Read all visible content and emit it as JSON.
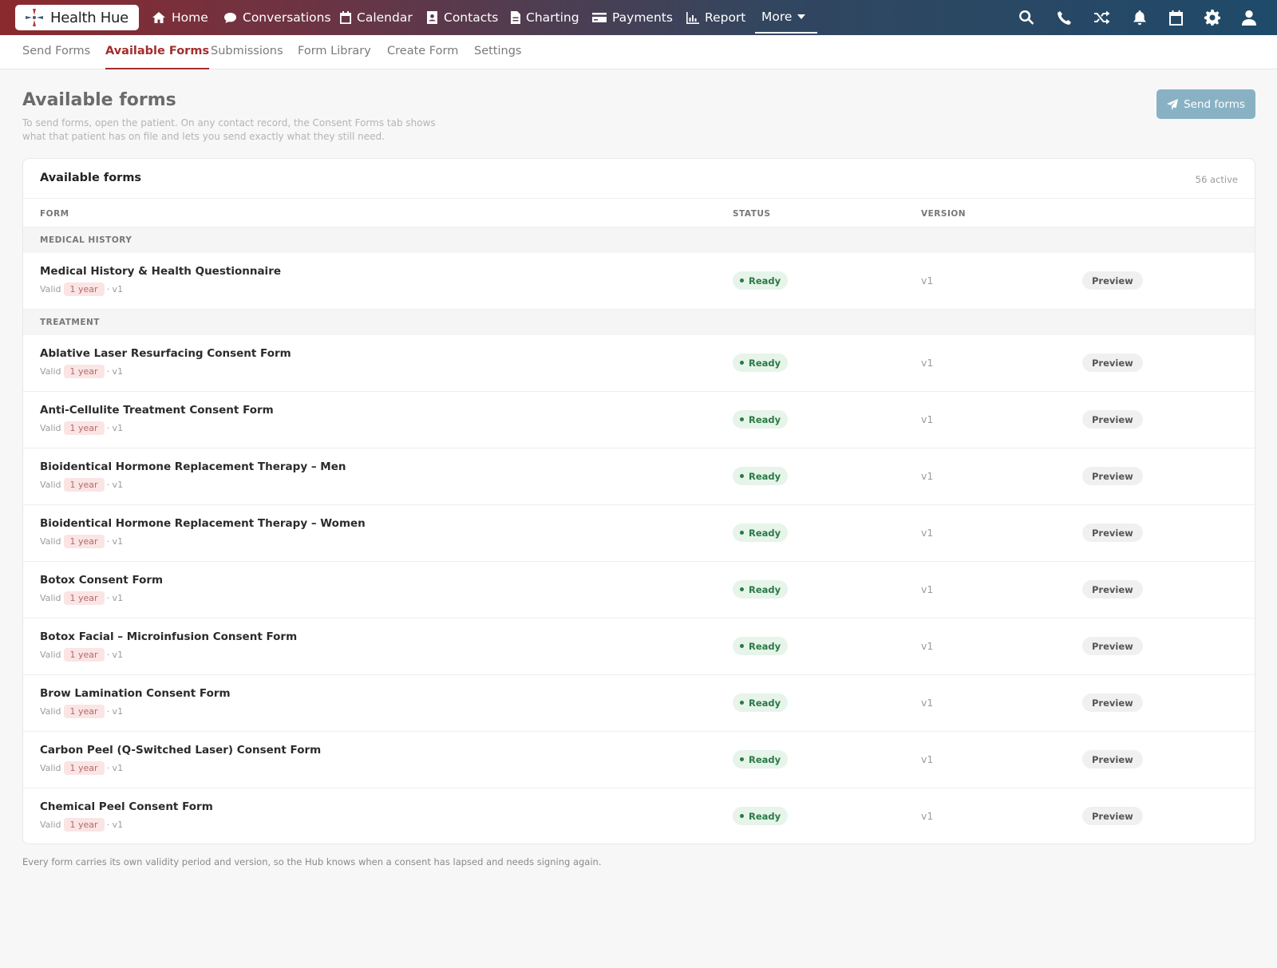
{
  "brand": {
    "name": "Health Hue"
  },
  "nav": {
    "items": [
      {
        "label": "Home",
        "icon": "home-icon"
      },
      {
        "label": "Conversations",
        "icon": "chat-bubble-icon"
      },
      {
        "label": "Calendar",
        "icon": "calendar-icon"
      },
      {
        "label": "Contacts",
        "icon": "contact-card-icon"
      },
      {
        "label": "Charting",
        "icon": "document-icon"
      },
      {
        "label": "Payments",
        "icon": "credit-card-icon"
      },
      {
        "label": "Report",
        "icon": "bar-chart-icon"
      }
    ],
    "more_label": "More",
    "right_icons": [
      "search-icon",
      "phone-icon",
      "shuffle-icon",
      "bell-icon",
      "calendar-icon",
      "gear-icon",
      "user-icon"
    ]
  },
  "subnav": {
    "tabs": [
      {
        "label": "Send Forms",
        "active": false
      },
      {
        "label": "Available Forms",
        "active": true
      },
      {
        "label": "Submissions",
        "active": false
      },
      {
        "label": "Form Library",
        "active": false
      },
      {
        "label": "Create Form",
        "active": false
      },
      {
        "label": "Settings",
        "active": false
      }
    ]
  },
  "header": {
    "title": "Available forms",
    "description": "To send forms, open the patient. On any contact record, the Consent Forms tab shows what that patient has on file and lets you send exactly what they still need.",
    "send_button": "Send forms"
  },
  "card": {
    "title": "Available forms",
    "count": "56 active",
    "columns": {
      "form": "FORM",
      "status": "STATUS",
      "version": "VERSION"
    },
    "groups": [
      {
        "label": "MEDICAL HISTORY",
        "forms": [
          {
            "name": "Medical History & Health Questionnaire",
            "valid_label": "Valid",
            "validity": "1 year",
            "version_suffix": "· v1",
            "status": "Ready",
            "version": "v1",
            "action": "Preview"
          }
        ]
      },
      {
        "label": "TREATMENT",
        "forms": [
          {
            "name": "Ablative Laser Resurfacing Consent Form",
            "valid_label": "Valid",
            "validity": "1 year",
            "version_suffix": "· v1",
            "status": "Ready",
            "version": "v1",
            "action": "Preview"
          },
          {
            "name": "Anti-Cellulite Treatment Consent Form",
            "valid_label": "Valid",
            "validity": "1 year",
            "version_suffix": "· v1",
            "status": "Ready",
            "version": "v1",
            "action": "Preview"
          },
          {
            "name": "Bioidentical Hormone Replacement Therapy – Men",
            "valid_label": "Valid",
            "validity": "1 year",
            "version_suffix": "· v1",
            "status": "Ready",
            "version": "v1",
            "action": "Preview"
          },
          {
            "name": "Bioidentical Hormone Replacement Therapy – Women",
            "valid_label": "Valid",
            "validity": "1 year",
            "version_suffix": "· v1",
            "status": "Ready",
            "version": "v1",
            "action": "Preview"
          },
          {
            "name": "Botox Consent Form",
            "valid_label": "Valid",
            "validity": "1 year",
            "version_suffix": "· v1",
            "status": "Ready",
            "version": "v1",
            "action": "Preview"
          },
          {
            "name": "Botox Facial – Microinfusion Consent Form",
            "valid_label": "Valid",
            "validity": "1 year",
            "version_suffix": "· v1",
            "status": "Ready",
            "version": "v1",
            "action": "Preview"
          },
          {
            "name": "Brow Lamination Consent Form",
            "valid_label": "Valid",
            "validity": "1 year",
            "version_suffix": "· v1",
            "status": "Ready",
            "version": "v1",
            "action": "Preview"
          },
          {
            "name": "Carbon Peel (Q-Switched Laser) Consent Form",
            "valid_label": "Valid",
            "validity": "1 year",
            "version_suffix": "· v1",
            "status": "Ready",
            "version": "v1",
            "action": "Preview"
          },
          {
            "name": "Chemical Peel Consent Form",
            "valid_label": "Valid",
            "validity": "1 year",
            "version_suffix": "· v1",
            "status": "Ready",
            "version": "v1",
            "action": "Preview"
          }
        ]
      }
    ]
  },
  "footnote": "Every form carries its own validity period and version, so the Hub knows when a consent has lapsed and needs signing again.",
  "colors": {
    "accent": "#a32d2d",
    "ready_bg": "#e6f4e9",
    "ready_text": "#2a7a45",
    "send_button": "#88b2c4"
  }
}
